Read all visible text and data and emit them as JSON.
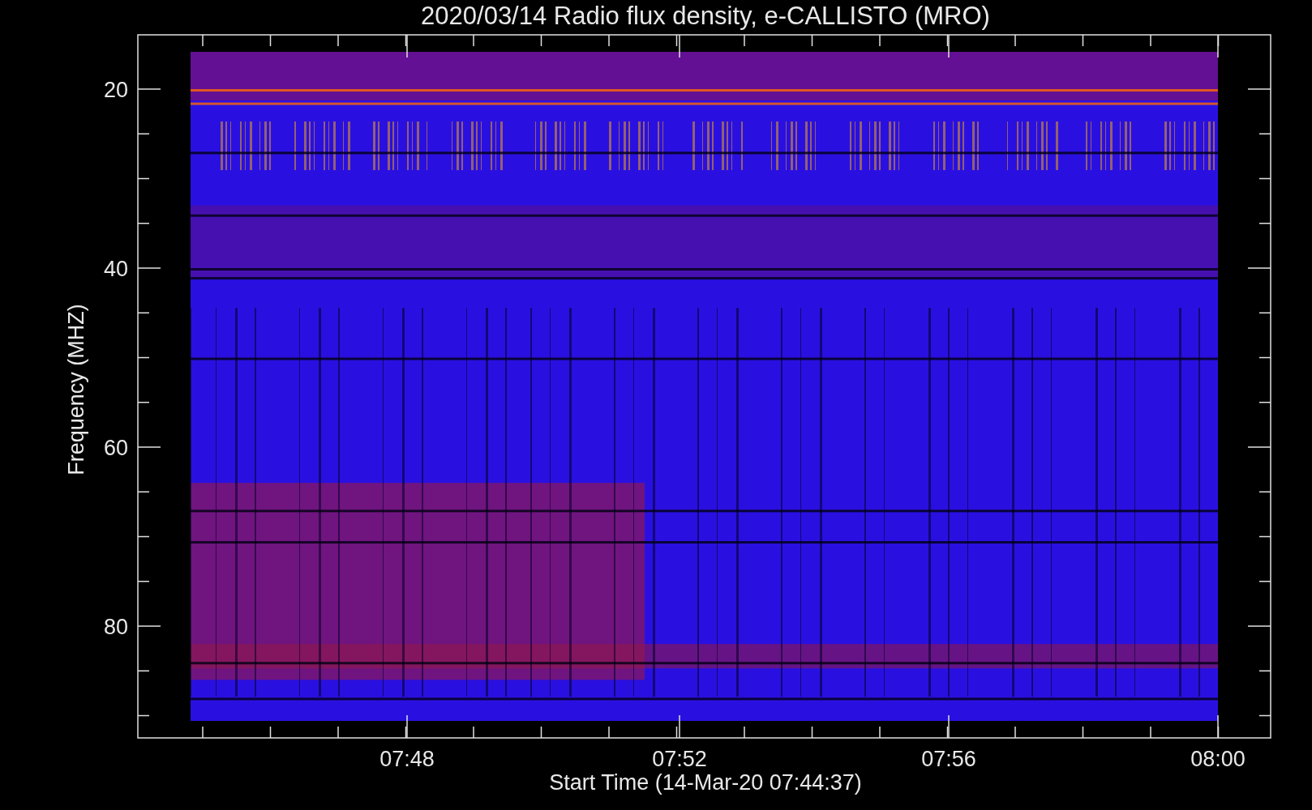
{
  "title": "2020/03/14  Radio flux density, e-CALLISTO (MRO)",
  "y_axis": {
    "label": "Frequency (MHZ)",
    "ticks": [
      "20",
      "40",
      "60",
      "80"
    ]
  },
  "x_axis": {
    "label": "Start Time (14-Mar-20 07:44:37)",
    "ticks": [
      "07:48",
      "07:52",
      "07:56",
      "08:00"
    ]
  }
}
